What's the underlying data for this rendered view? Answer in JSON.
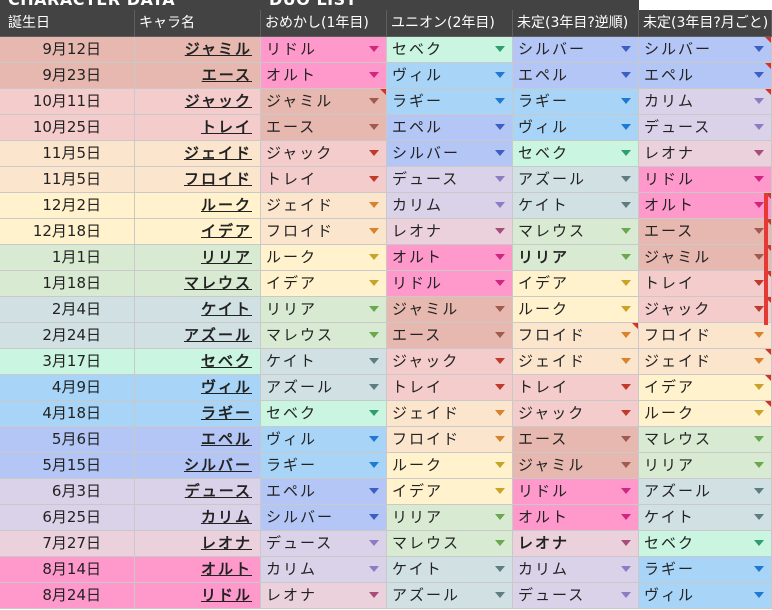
{
  "bands": {
    "character_data": "CHARACTER DATA",
    "duo_list": "DUO LIST"
  },
  "headers": [
    "誕生日",
    "キャラ名",
    "おめかし(1年目)",
    "ユニオン(2年目)",
    "未定(3年目?逆順)",
    "未定(3年目?月ごと)"
  ],
  "colors": {
    "header_bg": "#434343",
    "note_marker": "#d93025",
    "selection_border": "#e53935"
  },
  "palette": {
    "ジャミル": "#e6b8af",
    "エース": "#e6b8af",
    "ジャック": "#f4cccc",
    "トレイ": "#f4cccc",
    "ジェイド": "#fce5cd",
    "フロイド": "#fce5cd",
    "ルーク": "#fff2cc",
    "イデア": "#fff2cc",
    "リリア": "#d9ead3",
    "マレウス": "#d9ead3",
    "ケイト": "#d0e0e3",
    "アズール": "#d0e0e3",
    "セベク": "#c9f5e1",
    "ヴィル": "#a8d5f7",
    "ラギー": "#a8d5f7",
    "エペル": "#b4c6f5",
    "シルバー": "#b4c6f5",
    "デュース": "#d9d2e9",
    "カリム": "#d9d2e9",
    "レオナ": "#ead1dc",
    "オルト": "#ff99cc",
    "リドル": "#ff99cc"
  },
  "arrow_colors": {
    "ジャミル": "#a05a50",
    "エース": "#a05a50",
    "ジャック": "#c0392b",
    "トレイ": "#c0392b",
    "ジェイド": "#d9822b",
    "フロイド": "#d9822b",
    "ルーク": "#c9a227",
    "イデア": "#c9a227",
    "リリア": "#6aa84f",
    "マレウス": "#6aa84f",
    "ケイト": "#5f7c80",
    "アズール": "#5f7c80",
    "セベク": "#2e9e6e",
    "ヴィル": "#1f78d1",
    "ラギー": "#1f78d1",
    "エペル": "#3d5fc4",
    "シルバー": "#3d5fc4",
    "デュース": "#8e7cc3",
    "カリム": "#8e7cc3",
    "レオナ": "#a64d79",
    "オルト": "#d0267f",
    "リドル": "#d0267f"
  },
  "rows": [
    {
      "date": "9月12日",
      "name": "ジャミル",
      "duo": [
        "リドル",
        "セベク",
        "シルバー",
        "シルバー"
      ]
    },
    {
      "date": "9月23日",
      "name": "エース",
      "duo": [
        "オルト",
        "ヴィル",
        "エペル",
        "エペル"
      ]
    },
    {
      "date": "10月11日",
      "name": "ジャック",
      "duo": [
        "ジャミル",
        "ラギー",
        "ラギー",
        "カリム"
      ]
    },
    {
      "date": "10月25日",
      "name": "トレイ",
      "duo": [
        "エース",
        "エペル",
        "ヴィル",
        "デュース"
      ]
    },
    {
      "date": "11月5日",
      "name": "ジェイド",
      "duo": [
        "ジャック",
        "シルバー",
        "セベク",
        "レオナ"
      ]
    },
    {
      "date": "11月5日",
      "name": "フロイド",
      "duo": [
        "トレイ",
        "デュース",
        "アズール",
        "リドル"
      ]
    },
    {
      "date": "12月2日",
      "name": "ルーク",
      "duo": [
        "ジェイド",
        "カリム",
        "ケイト",
        "オルト"
      ]
    },
    {
      "date": "12月18日",
      "name": "イデア",
      "duo": [
        "フロイド",
        "レオナ",
        "マレウス",
        "エース"
      ]
    },
    {
      "date": "1月1日",
      "name": "リリア",
      "duo": [
        "ルーク",
        "オルト",
        "リリア",
        "ジャミル"
      ]
    },
    {
      "date": "1月18日",
      "name": "マレウス",
      "duo": [
        "イデア",
        "リドル",
        "イデア",
        "トレイ"
      ]
    },
    {
      "date": "2月4日",
      "name": "ケイト",
      "duo": [
        "リリア",
        "ジャミル",
        "ルーク",
        "ジャック"
      ]
    },
    {
      "date": "2月24日",
      "name": "アズール",
      "duo": [
        "マレウス",
        "エース",
        "フロイド",
        "フロイド"
      ]
    },
    {
      "date": "3月17日",
      "name": "セベク",
      "duo": [
        "ケイト",
        "ジャック",
        "ジェイド",
        "ジェイド"
      ]
    },
    {
      "date": "4月9日",
      "name": "ヴィル",
      "duo": [
        "アズール",
        "トレイ",
        "トレイ",
        "イデア"
      ]
    },
    {
      "date": "4月18日",
      "name": "ラギー",
      "duo": [
        "セベク",
        "ジェイド",
        "ジャック",
        "ルーク"
      ]
    },
    {
      "date": "5月6日",
      "name": "エペル",
      "duo": [
        "ヴィル",
        "フロイド",
        "エース",
        "マレウス"
      ]
    },
    {
      "date": "5月15日",
      "name": "シルバー",
      "duo": [
        "ラギー",
        "ルーク",
        "ジャミル",
        "リリア"
      ]
    },
    {
      "date": "6月3日",
      "name": "デュース",
      "duo": [
        "エペル",
        "イデア",
        "リドル",
        "アズール"
      ]
    },
    {
      "date": "6月25日",
      "name": "カリム",
      "duo": [
        "シルバー",
        "リリア",
        "オルト",
        "ケイト"
      ]
    },
    {
      "date": "7月27日",
      "name": "レオナ",
      "duo": [
        "デュース",
        "マレウス",
        "レオナ",
        "セベク"
      ]
    },
    {
      "date": "8月14日",
      "name": "オルト",
      "duo": [
        "カリム",
        "ケイト",
        "カリム",
        "ラギー"
      ]
    },
    {
      "date": "8月24日",
      "name": "リドル",
      "duo": [
        "レオナ",
        "アズール",
        "デュース",
        "ヴィル"
      ]
    }
  ]
}
